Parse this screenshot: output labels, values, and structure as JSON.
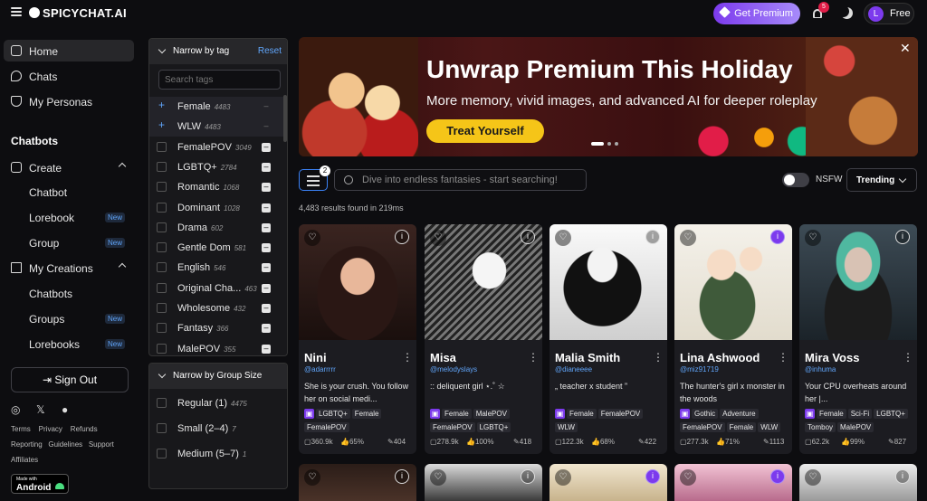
{
  "app": {
    "logo": "SPICYCHAT.AI"
  },
  "topbar": {
    "premium_label": "Get Premium",
    "notification_count": "5",
    "user_initial": "L",
    "plan_label": "Free"
  },
  "sidebar": {
    "home": "Home",
    "chats": "Chats",
    "personas": "My Personas",
    "chatbots_title": "Chatbots",
    "create": "Create",
    "chatbot": "Chatbot",
    "lorebook": "Lorebook",
    "group": "Group",
    "my_creations": "My Creations",
    "chatbots": "Chatbots",
    "groups": "Groups",
    "lorebooks": "Lorebooks",
    "new_badge": "New",
    "sign_out": "Sign Out",
    "links1": [
      "Terms",
      "Privacy",
      "Refunds"
    ],
    "links2": [
      "Reporting",
      "Guidelines",
      "Support"
    ],
    "links3": [
      "Affiliates"
    ],
    "android_small": "Made with",
    "android_big": "Android"
  },
  "tag_panel": {
    "title": "Narrow by tag",
    "reset": "Reset",
    "search_placeholder": "Search tags",
    "tags": [
      {
        "name": "Female",
        "count": "4483"
      },
      {
        "name": "WLW",
        "count": "4483"
      },
      {
        "name": "FemalePOV",
        "count": "3049"
      },
      {
        "name": "LGBTQ+",
        "count": "2784"
      },
      {
        "name": "Romantic",
        "count": "1068"
      },
      {
        "name": "Dominant",
        "count": "1028"
      },
      {
        "name": "Drama",
        "count": "602"
      },
      {
        "name": "Gentle Dom",
        "count": "581"
      },
      {
        "name": "English",
        "count": "546"
      },
      {
        "name": "Original Cha...",
        "count": "463"
      },
      {
        "name": "Wholesome",
        "count": "432"
      },
      {
        "name": "Fantasy",
        "count": "366"
      },
      {
        "name": "MalePOV",
        "count": "355"
      }
    ]
  },
  "group_panel": {
    "title": "Narrow by Group Size",
    "options": [
      {
        "name": "Regular (1)",
        "count": "4475"
      },
      {
        "name": "Small (2–4)",
        "count": "7"
      },
      {
        "name": "Medium (5–7)",
        "count": "1"
      }
    ]
  },
  "banner": {
    "title": "Unwrap Premium This Holiday",
    "subtitle": "More memory, vivid images, and advanced AI for deeper roleplay",
    "cta": "Treat Yourself"
  },
  "search": {
    "placeholder": "Dive into endless fantasies - start searching!",
    "filter_count": "2",
    "nsfw_label": "NSFW",
    "sort": "Trending"
  },
  "results_text": "4,483 results found in 219ms",
  "cards": [
    {
      "name": "Nini",
      "handle": "@adarrrrr",
      "desc": "She is your crush. You follow her on social medi...",
      "tags": [
        "LGBTQ+",
        "Female",
        "FemalePOV"
      ],
      "chats": "360.9k",
      "rating": "65%",
      "count": "404"
    },
    {
      "name": "Misa",
      "handle": "@melodyslays",
      "desc": ":: deliquent girl ⋆.˚ ☆",
      "tags": [
        "Female",
        "MalePOV",
        "FemalePOV",
        "LGBTQ+"
      ],
      "chats": "278.9k",
      "rating": "100%",
      "count": "418"
    },
    {
      "name": "Malia Smith",
      "handle": "@dianeeee",
      "desc": "„ teacher x student ”",
      "tags": [
        "Female",
        "FemalePOV",
        "WLW"
      ],
      "chats": "122.3k",
      "rating": "68%",
      "count": "422"
    },
    {
      "name": "Lina Ashwood",
      "handle": "@miz91719",
      "desc": "The hunter's girl x monster in the woods",
      "tags": [
        "Gothic",
        "Adventure",
        "FemalePOV",
        "Female",
        "WLW"
      ],
      "chats": "277.3k",
      "rating": "71%",
      "count": "1113"
    },
    {
      "name": "Mira Voss",
      "handle": "@inhuma",
      "desc": "Your CPU overheats around her |...",
      "tags": [
        "Female",
        "Sci-Fi",
        "LGBTQ+",
        "Tomboy",
        "MalePOV"
      ],
      "chats": "62.2k",
      "rating": "99%",
      "count": "827"
    }
  ],
  "colors": {
    "accent": "#7c3aed",
    "link": "#60a5fa",
    "cta": "#f5c518",
    "bg": "#0d0d10"
  }
}
